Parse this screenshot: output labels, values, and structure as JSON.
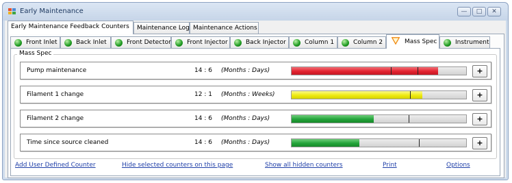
{
  "window": {
    "title": "Early Maintenance",
    "minimize_glyph": "—",
    "maximize_glyph": "□",
    "close_glyph": "✕"
  },
  "main_tabs": [
    {
      "label": "Early Maintenance Feedback Counters",
      "active": true
    },
    {
      "label": "Maintenance Log",
      "active": false
    },
    {
      "label": "Maintenance Actions",
      "active": false
    }
  ],
  "sub_tabs": [
    {
      "label": "Front Inlet",
      "icon": "green-status-icon"
    },
    {
      "label": "Back Inlet",
      "icon": "green-status-icon"
    },
    {
      "label": "Front Detector",
      "icon": "green-status-icon"
    },
    {
      "label": "Front Injector",
      "icon": "green-status-icon"
    },
    {
      "label": "Back Injector",
      "icon": "green-status-icon"
    },
    {
      "label": "Column 1",
      "icon": "green-status-icon"
    },
    {
      "label": "Column 2",
      "icon": "green-status-icon"
    },
    {
      "label": "Mass Spec",
      "icon": "warning-triangle-icon",
      "active": true
    },
    {
      "label": "Instrument",
      "icon": "green-status-icon"
    }
  ],
  "group": {
    "label": "Mass Spec"
  },
  "counters": [
    {
      "name": "Pump maintenance",
      "value": "14 : 6",
      "units": "(Months : Days)",
      "progress": 0.84,
      "color": "#e3232f",
      "markers": [
        0.57,
        0.72
      ]
    },
    {
      "name": "Filament 1 change",
      "value": "12 : 1",
      "units": "(Months : Weeks)",
      "progress": 0.75,
      "color": "#eeea12",
      "markers": [
        0.68
      ]
    },
    {
      "name": "Filament 2 change",
      "value": "14 : 6",
      "units": "(Months : Days)",
      "progress": 0.47,
      "color": "#23a33a",
      "markers": [
        0.67
      ]
    },
    {
      "name": "Time since source cleaned",
      "value": "14 : 6",
      "units": "(Months : Days)",
      "progress": 0.39,
      "color": "#23a33a",
      "markers": [
        0.73
      ]
    }
  ],
  "plus_label": "+",
  "links": {
    "add_counter": "Add User Defined Counter",
    "hide_selected": "Hide selected counters on this page",
    "show_hidden": "Show all hidden counters",
    "print": "Print",
    "options": "Options"
  }
}
